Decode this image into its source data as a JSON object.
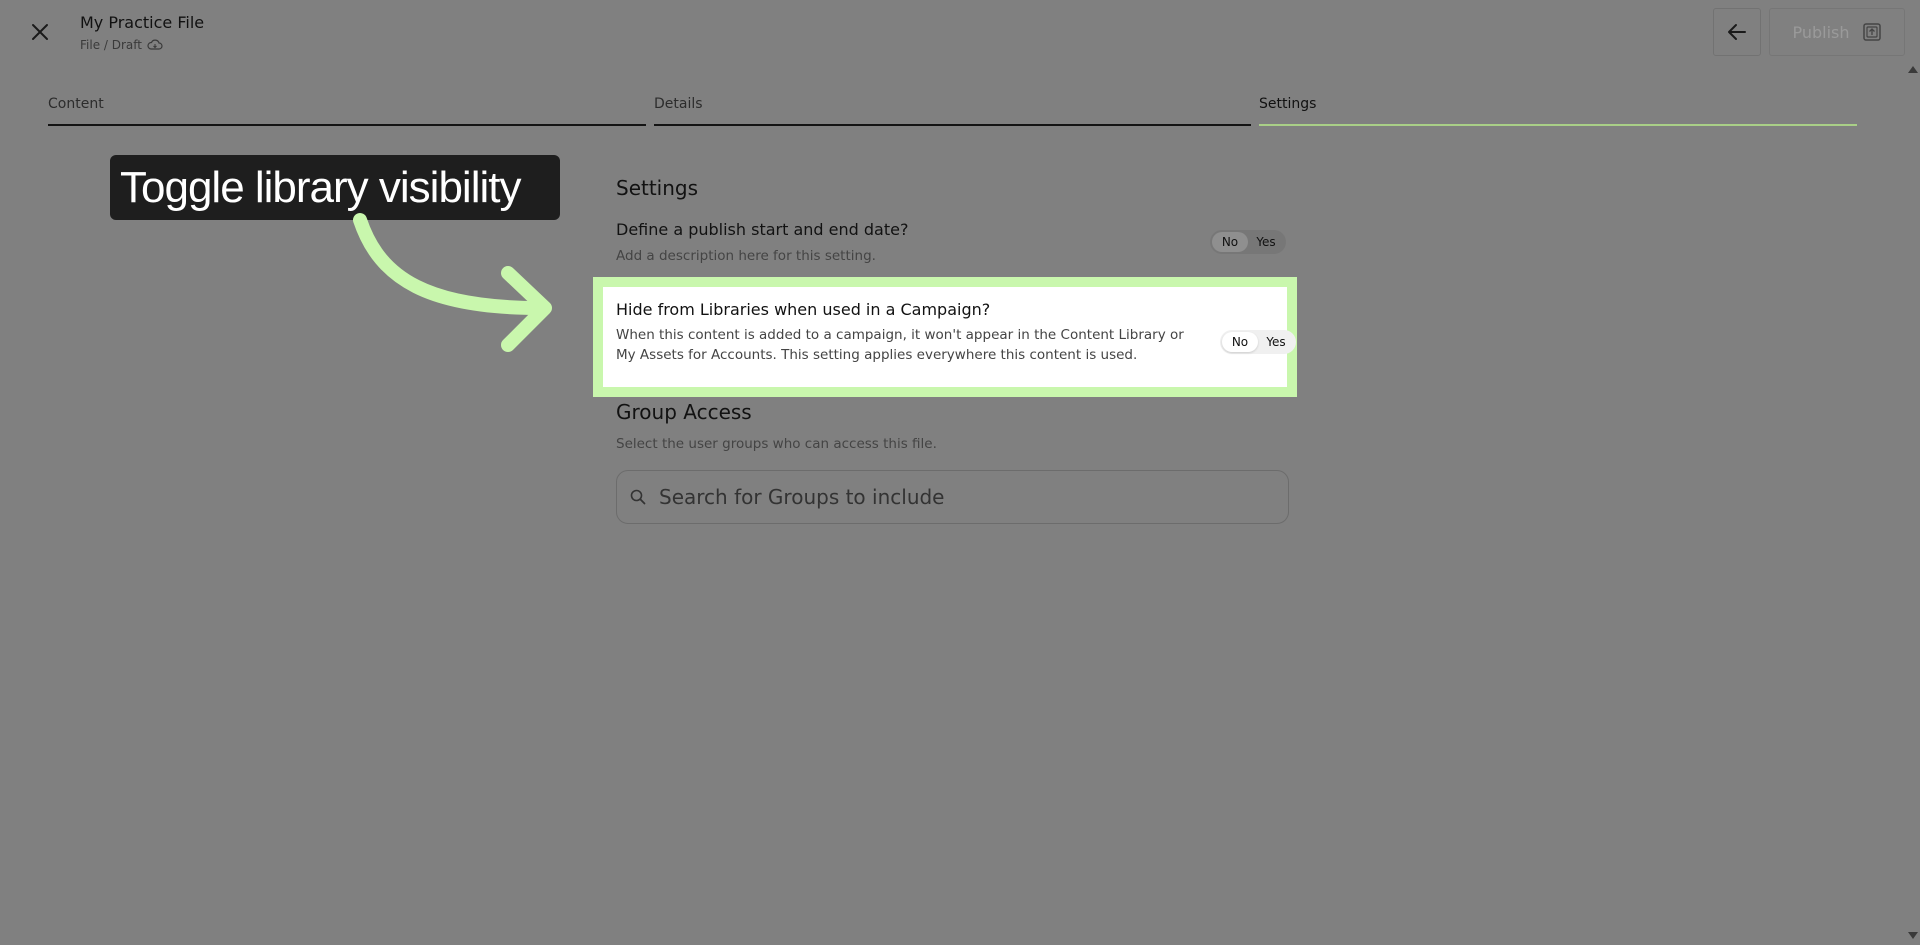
{
  "header": {
    "title": "My Practice File",
    "breadcrumb": "File / Draft",
    "publish_label": "Publish"
  },
  "tabs": [
    {
      "label": "Content",
      "active": false
    },
    {
      "label": "Details",
      "active": false
    },
    {
      "label": "Settings",
      "active": true
    }
  ],
  "settings": {
    "section_title": "Settings",
    "items": [
      {
        "label": "Define a publish start and end date?",
        "description": "Add a description here for this setting.",
        "toggle": {
          "no": "No",
          "yes": "Yes",
          "selected": "No"
        }
      },
      {
        "label": "Hide from Libraries when used in a Campaign?",
        "description": "When this content is added to a campaign, it won't appear in the Content Library or My Assets for Accounts. This setting applies everywhere this content is used.",
        "toggle": {
          "no": "No",
          "yes": "Yes",
          "selected": "No"
        }
      }
    ]
  },
  "group_access": {
    "title": "Group Access",
    "description": "Select the user groups who can access this file.",
    "search_placeholder": "Search for Groups to include"
  },
  "annotation": {
    "callout_text": "Toggle library visibility",
    "highlight_color": "#c9f7ad",
    "accent_color": "#a9cf87"
  },
  "icons": [
    "close-icon",
    "cloud-icon",
    "arrow-left-icon",
    "publish-icon",
    "search-icon"
  ]
}
